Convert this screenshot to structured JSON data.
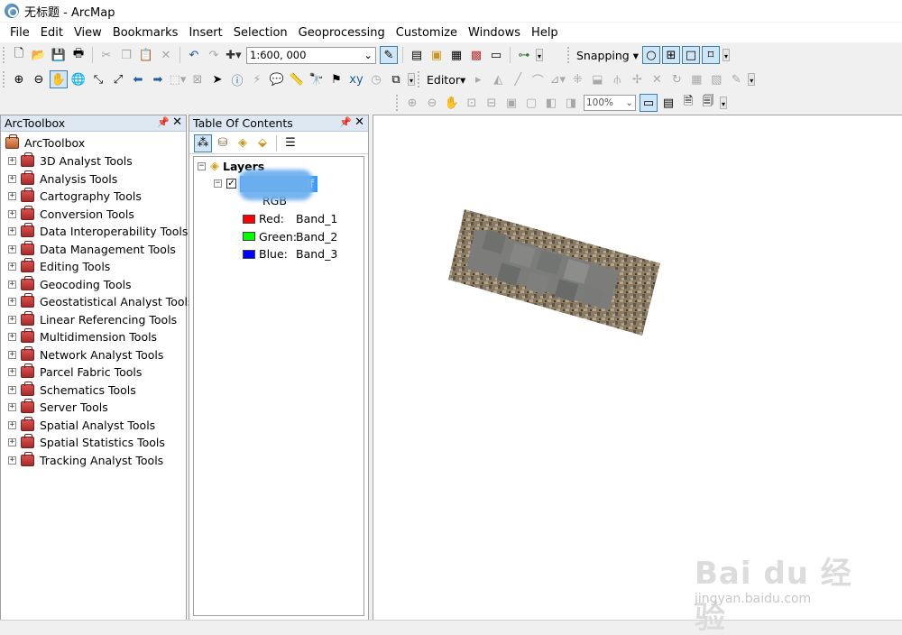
{
  "window": {
    "title": "无标题 - ArcMap"
  },
  "menu": [
    "File",
    "Edit",
    "View",
    "Bookmarks",
    "Insert",
    "Selection",
    "Geoprocessing",
    "Customize",
    "Windows",
    "Help"
  ],
  "toolbar": {
    "scale_value": "1:600, 000",
    "snapping_label": "Snapping",
    "editor_label": "Editor",
    "zoom_value": "100%"
  },
  "arctoolbox": {
    "header": "ArcToolbox",
    "root": "ArcToolbox",
    "items": [
      "3D Analyst Tools",
      "Analysis Tools",
      "Cartography Tools",
      "Conversion Tools",
      "Data Interoperability Tools",
      "Data Management Tools",
      "Editing Tools",
      "Geocoding Tools",
      "Geostatistical Analyst Tools",
      "Linear Referencing Tools",
      "Multidimension Tools",
      "Network Analyst Tools",
      "Parcel Fabric Tools",
      "Schematics Tools",
      "Server Tools",
      "Spatial Analyst Tools",
      "Spatial Statistics Tools",
      "Tracking Analyst Tools"
    ]
  },
  "toc": {
    "header": "Table Of Contents",
    "layers_label": "Layers",
    "layer_name_suffix": "if",
    "layer_checked": true,
    "render_type": "RGB",
    "bands": [
      {
        "channel": "Red:",
        "band": "Band_1",
        "color": "#ff0000"
      },
      {
        "channel": "Green:",
        "band": "Band_2",
        "color": "#00ff00"
      },
      {
        "channel": "Blue:",
        "band": "Band_3",
        "color": "#0000ff"
      }
    ]
  },
  "watermark": {
    "main": "Bai du 经验",
    "sub": "jingyan.baidu.com"
  }
}
